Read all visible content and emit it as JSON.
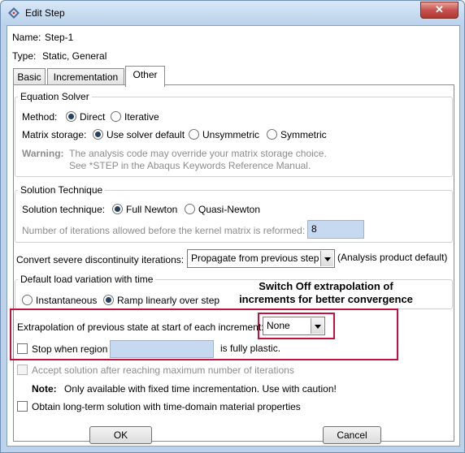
{
  "window": {
    "title": "Edit Step",
    "close_glyph": "✕"
  },
  "step": {
    "name_label": "Name:",
    "name_value": "Step-1",
    "type_label": "Type:",
    "type_value": "Static, General"
  },
  "tabs": [
    {
      "label": "Basic"
    },
    {
      "label": "Incrementation"
    },
    {
      "label": "Other"
    }
  ],
  "equation_solver": {
    "legend": "Equation Solver",
    "method_label": "Method:",
    "method_options": [
      {
        "label": "Direct",
        "selected": true
      },
      {
        "label": "Iterative",
        "selected": false
      }
    ],
    "matrix_label": "Matrix storage:",
    "matrix_options": [
      {
        "label": "Use solver default",
        "selected": true
      },
      {
        "label": "Unsymmetric",
        "selected": false
      },
      {
        "label": "Symmetric",
        "selected": false
      }
    ],
    "warning_label": "Warning:",
    "warning_line1": "The analysis code may override your matrix storage choice.",
    "warning_line2": "See *STEP in the Abaqus Keywords Reference Manual."
  },
  "solution_technique": {
    "legend": "Solution Technique",
    "label": "Solution technique:",
    "options": [
      {
        "label": "Full Newton",
        "selected": true
      },
      {
        "label": "Quasi-Newton",
        "selected": false
      }
    ],
    "iterations_label": "Number of iterations allowed before the kernel matrix is reformed:",
    "iterations_value": "8"
  },
  "discontinuity": {
    "label": "Convert severe discontinuity iterations:",
    "value": "Propagate from previous step",
    "note": "(Analysis product default)"
  },
  "load_variation": {
    "legend": "Default load variation with time",
    "options": [
      {
        "label": "Instantaneous",
        "selected": false
      },
      {
        "label": "Ramp linearly over step",
        "selected": true
      }
    ]
  },
  "annotation": {
    "line1": "Switch Off extrapolation of",
    "line2": "increments for better convergence",
    "highlight_color": "#c8103f"
  },
  "extrapolation": {
    "label": "Extrapolation of previous state at start of each increment:",
    "value": "None"
  },
  "stop_region": {
    "label": "Stop when region",
    "suffix": "is fully plastic.",
    "checked": false
  },
  "accept_solution": {
    "label": "Accept solution after reaching maximum number of iterations",
    "enabled": false
  },
  "note": {
    "label": "Note:",
    "text": "Only available with fixed time incrementation. Use with caution!"
  },
  "long_term": {
    "label": "Obtain long-term solution with time-domain material properties",
    "checked": false
  },
  "buttons": {
    "ok": "OK",
    "cancel": "Cancel"
  },
  "colors": {
    "entry_fill": "#c6d9f0",
    "title_bar": "#bcd2ea"
  }
}
